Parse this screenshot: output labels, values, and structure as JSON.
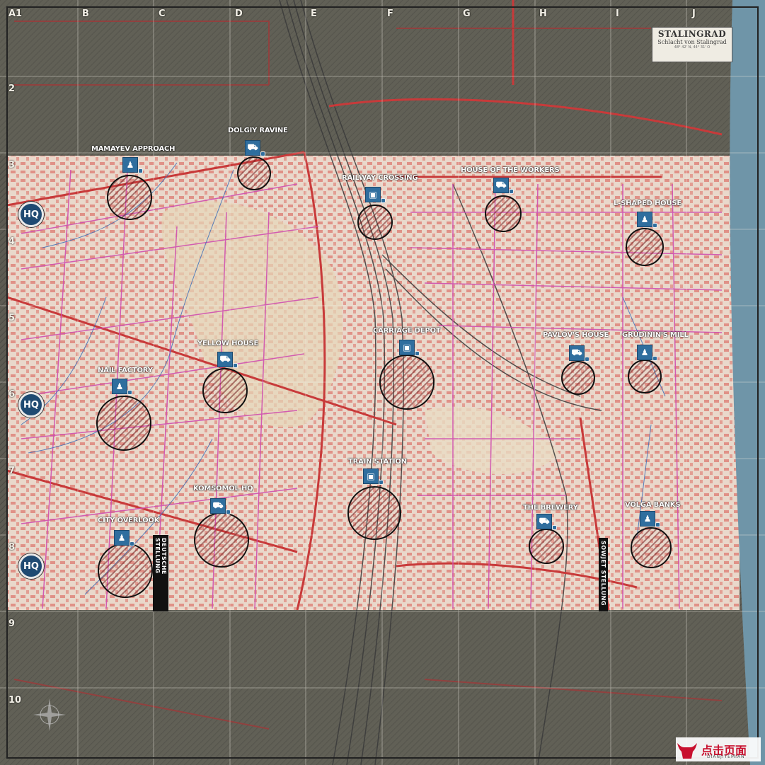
{
  "map": {
    "title": "STALINGRAD",
    "subtitle": "Schlacht von Stalingrad",
    "coords": "48° 42' N, 44° 31' O",
    "grid_columns": [
      "A1",
      "B",
      "C",
      "D",
      "E",
      "F",
      "G",
      "H",
      "I",
      "J"
    ],
    "grid_rows": [
      "2",
      "3",
      "4",
      "5",
      "6",
      "7",
      "8",
      "9",
      "10"
    ],
    "hq_label": "HQ",
    "german_line_label": "DEUTSCHE STELLUNG",
    "soviet_line_label": "SOWJET STELLUNG",
    "colors": {
      "playable_area": "#e8d6c8",
      "out_of_bounds": "#5a5a52",
      "roads_major": "#c83a3a",
      "roads_minor": "#d04fb0",
      "streams": "#3d6fb8",
      "buildings": "#d9544d",
      "river": "#6f95a8",
      "objective_icon": "#2f6e9e",
      "hq_marker": "#1f4a72"
    }
  },
  "objectives": [
    {
      "name": "DOLGIY RAVINE",
      "icon": "truck-icon"
    },
    {
      "name": "MAMAYEV APPROACH",
      "icon": "soldier-icon"
    },
    {
      "name": "RAILWAY CROSSING",
      "icon": "train-icon"
    },
    {
      "name": "HOUSE OF THE WORKERS",
      "icon": "truck-icon"
    },
    {
      "name": "L-SHAPED HOUSE",
      "icon": "soldier-icon"
    },
    {
      "name": "CARRIAGE DEPOT",
      "icon": "train-icon"
    },
    {
      "name": "YELLOW HOUSE",
      "icon": "truck-icon"
    },
    {
      "name": "PAVLOV'S HOUSE",
      "icon": "truck-icon"
    },
    {
      "name": "GRUDININ'S MILL",
      "icon": "soldier-icon"
    },
    {
      "name": "NAIL FACTORY",
      "icon": "soldier-icon"
    },
    {
      "name": "TRAIN STATION",
      "icon": "train-icon"
    },
    {
      "name": "KOMSOMOL HQ",
      "icon": "truck-icon"
    },
    {
      "name": "THE BREWERY",
      "icon": "truck-icon"
    },
    {
      "name": "VOLGA BANKS",
      "icon": "soldier-icon"
    },
    {
      "name": "CITY OVERLOOK",
      "icon": "soldier-icon"
    }
  ],
  "watermark": {
    "text": "点击页面",
    "sub": "DIANJIYEMIAN"
  }
}
